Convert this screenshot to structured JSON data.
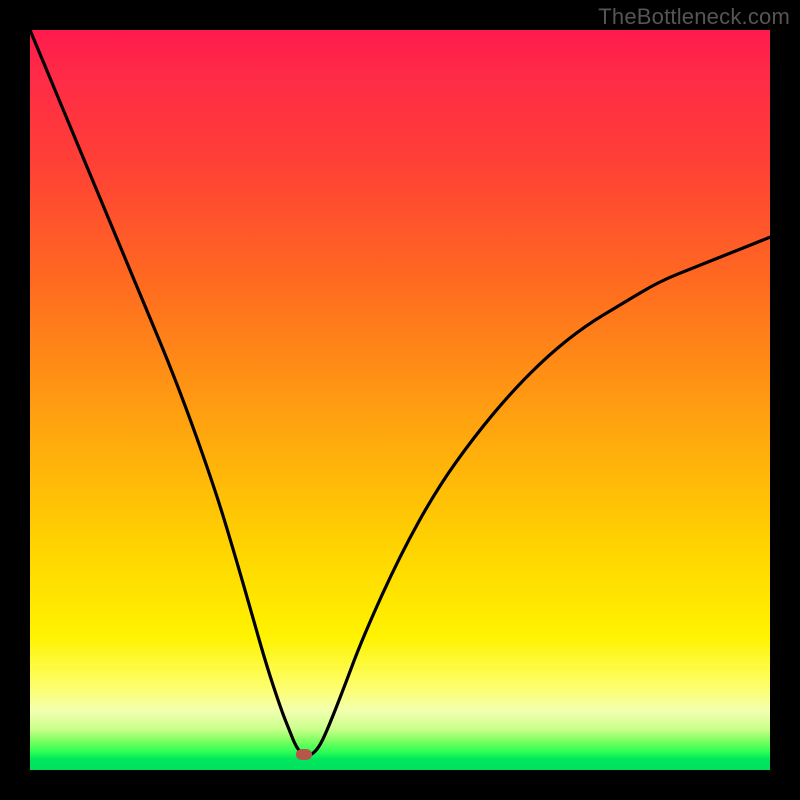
{
  "watermark": "TheBottleneck.com",
  "chart_data": {
    "type": "line",
    "title": "",
    "xlabel": "",
    "ylabel": "",
    "xlim": [
      0,
      100
    ],
    "ylim": [
      0,
      100
    ],
    "series": [
      {
        "name": "bottleneck-curve",
        "x": [
          0,
          5,
          10,
          15,
          20,
          25,
          28,
          30,
          32,
          34,
          35,
          36,
          37,
          38,
          39,
          40,
          42,
          45,
          50,
          55,
          60,
          65,
          70,
          75,
          80,
          85,
          90,
          95,
          100
        ],
        "values": [
          100,
          88,
          76,
          64,
          52,
          38,
          28,
          21,
          14,
          8,
          5.5,
          3,
          2,
          2,
          3,
          5,
          10,
          18,
          29,
          38,
          45,
          51,
          56,
          60,
          63,
          66,
          68,
          70,
          72
        ]
      }
    ],
    "marker": {
      "x": 37,
      "y": 2,
      "color": "#b5574a"
    },
    "gradient_stops": [
      {
        "pos": 0,
        "color": "#ff1a4d"
      },
      {
        "pos": 0.5,
        "color": "#ff9a12"
      },
      {
        "pos": 0.82,
        "color": "#fff300"
      },
      {
        "pos": 0.97,
        "color": "#2fff55"
      },
      {
        "pos": 1.0,
        "color": "#00e060"
      }
    ]
  }
}
